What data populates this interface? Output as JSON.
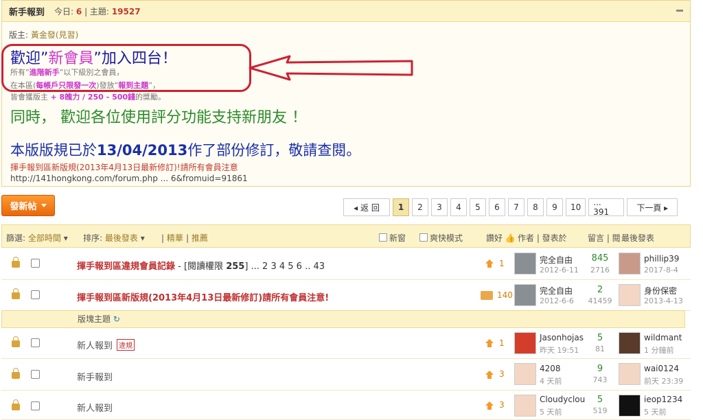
{
  "board": {
    "title": "新手報到",
    "today_label": "今日:",
    "today_value": "6",
    "topics_label": "主題:",
    "topics_value": "19527",
    "moderators_label": "版主:",
    "moderators_value": "黃金發(見習)",
    "welcome_pre": "歡迎”",
    "welcome_hl": "新會員",
    "welcome_post": "”加入四台！",
    "line2_pre": "所有”",
    "line2_hl": "進階新手",
    "line2_post": "”以下級別之會員，",
    "line3_pre": "在本區(",
    "line3_hl1": "每帳戶只限發一次",
    "line3_mid": ")發放”",
    "line3_hl2": "報到主題",
    "line3_post": "”，",
    "line4_pre": "皆會獲版主",
    "line4_hl": "+ 8魄力 / 250 - 500錢",
    "line4_post": "的獎勵。",
    "green_line": "同時， 歡迎各位使用評分功能支持新朋友 ！",
    "rule_pre": "本版版規已於",
    "rule_date": "13/04/2013",
    "rule_post": "作了部份修訂，敬請查閱。",
    "rule_link": "揮手報到區新版規(2013年4月13日最新修訂)!請所有會員注意",
    "rule_url": "http://141hongkong.com/forum.php ... 6&fromuid=91861"
  },
  "toolbar": {
    "new_post": "發新帖",
    "prev": "◂ 返 回",
    "pages": [
      "1",
      "2",
      "3",
      "4",
      "5",
      "6",
      "7",
      "8",
      "9",
      "10",
      "... 391"
    ],
    "next": "下一頁 ▸"
  },
  "filter": {
    "filter_label": "篩選:",
    "filter_value": "全部時間",
    "sort_label": "排序:",
    "sort_value": "最後發表",
    "essence": "精華",
    "recommend": "推薦",
    "new_window": "新窗",
    "fast_mode": "爽快模式",
    "likes": "讚好",
    "author_col": "作者 | 發表於",
    "reply_col": "留言 | 閱",
    "last_col": "最後發表"
  },
  "section_label": "版塊主題",
  "threads": [
    {
      "title": "揮手報到區違規會員記錄",
      "suffix": " - [閱讀權限 ",
      "perm": "255",
      "suffix2": "] ... 2  3  4  5  6 .. 43",
      "likes": "1",
      "author": "完全自由",
      "date": "2012-6-11",
      "replies": "845",
      "views": "2716",
      "last_user": "phillip39",
      "last_date": "2017-8-4"
    },
    {
      "title": "揮手報到區新版規(2013年4月13日最新修訂)請所有會員注意!",
      "likes": "140",
      "author": "完全自由",
      "date": "2012-6-6",
      "replies": "2",
      "views": "41459",
      "last_user": "身份保密",
      "last_date": "2013-4-13"
    },
    {
      "title": "新人報到",
      "tag": "違規",
      "likes": "1",
      "author": "Jasonhojas",
      "date": "昨天 19:51",
      "replies": "5",
      "views": "81",
      "last_user": "wildmant",
      "last_date": "1 分鐘前"
    },
    {
      "title": "新手報到",
      "likes": "3",
      "author": "4208",
      "date": "4 天前",
      "replies": "9",
      "views": "743",
      "last_user": "wai0124",
      "last_date": "前天 23:39"
    },
    {
      "title": "新人報到",
      "likes": "3",
      "author": "Cloudyclou",
      "date": "5 天前",
      "replies": "5",
      "views": "519",
      "last_user": "ieop1234",
      "last_date": "5 天前"
    }
  ],
  "colors": {
    "accent": "#e8680b",
    "highlight": "#cc2233",
    "header_bg": "#fdf3c9"
  }
}
